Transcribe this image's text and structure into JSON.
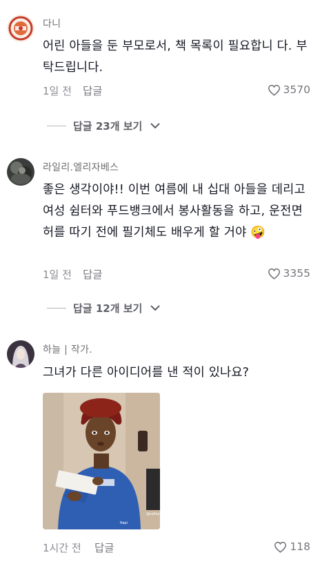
{
  "comments": [
    {
      "username": "다니",
      "text": "어린 아들을 둔 부모로서, 책 목록이 필요합니 다. 부탁드립니다.",
      "time": "1일 전",
      "reply_label": "답글",
      "likes": "3570",
      "view_replies": "답글 23개 보기"
    },
    {
      "username": "라일리.엘리자베스",
      "text": "좋은 생각이야!! 이번 여름에 내 십대 아들을 데리고 여성 쉼터와 푸드뱅크에서 봉사활동을 하고, 운전면허를 따기 전에 필기체도 배우게 할 거야 🤪",
      "time": "1일 전",
      "reply_label": "답글",
      "likes": "3355",
      "view_replies": "답글 12개 보기"
    },
    {
      "username": "하늘 | 작가.",
      "text": "그녀가 다른 아이디어를 낸 적이 있나요?",
      "time": "1시간 전",
      "reply_label": "답글",
      "likes": "118"
    }
  ],
  "colors": {
    "text_primary": "#161823",
    "text_secondary": "#75767c",
    "background": "#ffffff"
  }
}
